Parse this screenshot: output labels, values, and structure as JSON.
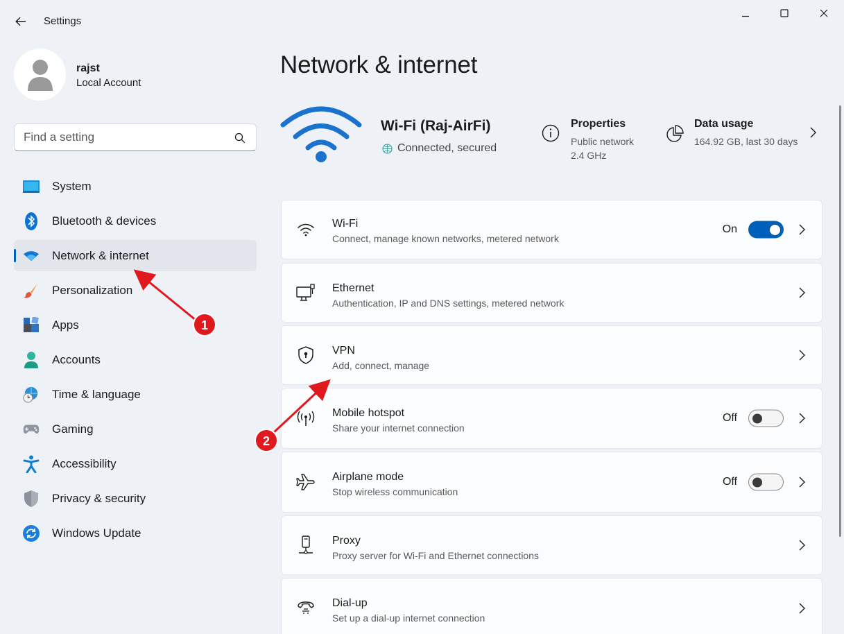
{
  "window": {
    "title": "Settings",
    "controls": [
      "minimize",
      "maximize",
      "close"
    ]
  },
  "account": {
    "name": "rajst",
    "type": "Local Account"
  },
  "search": {
    "placeholder": "Find a setting",
    "value": ""
  },
  "sidebar": {
    "items": [
      {
        "label": "System",
        "icon": "system-icon",
        "active": false
      },
      {
        "label": "Bluetooth & devices",
        "icon": "bluetooth-icon",
        "active": false
      },
      {
        "label": "Network & internet",
        "icon": "wifi-icon",
        "active": true
      },
      {
        "label": "Personalization",
        "icon": "paintbrush-icon",
        "active": false
      },
      {
        "label": "Apps",
        "icon": "apps-icon",
        "active": false
      },
      {
        "label": "Accounts",
        "icon": "person-icon",
        "active": false
      },
      {
        "label": "Time & language",
        "icon": "globe-clock-icon",
        "active": false
      },
      {
        "label": "Gaming",
        "icon": "gamepad-icon",
        "active": false
      },
      {
        "label": "Accessibility",
        "icon": "accessibility-icon",
        "active": false
      },
      {
        "label": "Privacy & security",
        "icon": "shield-icon",
        "active": false
      },
      {
        "label": "Windows Update",
        "icon": "refresh-icon",
        "active": false
      }
    ]
  },
  "main": {
    "title": "Network & internet",
    "connection": {
      "name": "Wi-Fi (Raj-AirFi)",
      "status": "Connected, secured"
    },
    "properties": {
      "title": "Properties",
      "line1": "Public network",
      "line2": "2.4 GHz"
    },
    "data_usage": {
      "title": "Data usage",
      "summary": "164.92 GB, last 30 days"
    },
    "cards": [
      {
        "title": "Wi-Fi",
        "subtitle": "Connect, manage known networks, metered network",
        "icon": "wifi-icon",
        "toggle": "On"
      },
      {
        "title": "Ethernet",
        "subtitle": "Authentication, IP and DNS settings, metered network",
        "icon": "ethernet-icon",
        "toggle": null
      },
      {
        "title": "VPN",
        "subtitle": "Add, connect, manage",
        "icon": "vpn-shield-icon",
        "toggle": null
      },
      {
        "title": "Mobile hotspot",
        "subtitle": "Share your internet connection",
        "icon": "hotspot-icon",
        "toggle": "Off"
      },
      {
        "title": "Airplane mode",
        "subtitle": "Stop wireless communication",
        "icon": "airplane-icon",
        "toggle": "Off"
      },
      {
        "title": "Proxy",
        "subtitle": "Proxy server for Wi-Fi and Ethernet connections",
        "icon": "proxy-icon",
        "toggle": null
      },
      {
        "title": "Dial-up",
        "subtitle": "Set up a dial-up internet connection",
        "icon": "dialup-icon",
        "toggle": null
      }
    ]
  },
  "annotations": {
    "marker1": "1",
    "marker2": "2"
  },
  "colors": {
    "accent": "#005fb8",
    "annotation": "#e0191e",
    "background": "#eef2f7"
  }
}
